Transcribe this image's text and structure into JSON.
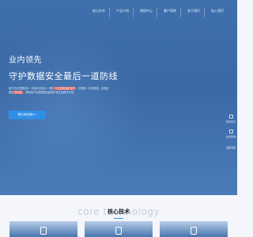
{
  "nav": {
    "items": [
      {
        "label": "核心技术"
      },
      {
        "label": "产品介绍"
      },
      {
        "label": "授权中心"
      },
      {
        "label": "客户案例"
      },
      {
        "label": "关于我们"
      },
      {
        "label": "加入我们"
      }
    ]
  },
  "hero": {
    "headline": "业内领先",
    "subheadline": "守护数据安全最后一道防线",
    "desc_part1": "基于前沿挖掘技术，利用可信技术，提供",
    "desc_highlight1": "可信透明加密保护",
    "desc_part2": "，归属唯一可信溯源，实现如",
    "desc_part3": "数据",
    "desc_highlight2": "防泄露",
    "desc_part4": "，帮助用户实现",
    "desc_part5": "数据全面保护及安全解决方案！",
    "cta_label": "预约系统演示 ›"
  },
  "sidebar": {
    "items": [
      {
        "label": "联系我们",
        "icon": "phone-icon"
      },
      {
        "label": "在线咨询",
        "icon": "chat-icon"
      }
    ],
    "top_label": "返回顶部"
  },
  "section": {
    "watermark": "core technology",
    "title": "核心技术"
  },
  "colors": {
    "hero_bg": "#3f6fad",
    "accent": "#2f8fe8",
    "highlight": "#e05a4f"
  }
}
